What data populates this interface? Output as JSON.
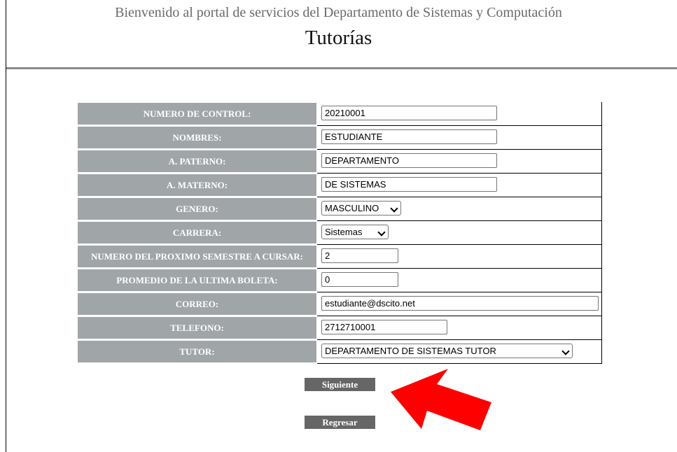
{
  "header": {
    "welcome": "Bienvenido al portal de servicios del Departamento de Sistemas y Computación",
    "title": "Tutorías"
  },
  "form": {
    "rows": [
      {
        "label": "NUMERO DE CONTROL:",
        "value": "20210001"
      },
      {
        "label": "NOMBRES:",
        "value": "ESTUDIANTE"
      },
      {
        "label": "A. PATERNO:",
        "value": "DEPARTAMENTO"
      },
      {
        "label": "A. MATERNO:",
        "value": "DE SISTEMAS"
      },
      {
        "label": "GENERO:",
        "value": "MASCULINO"
      },
      {
        "label": "CARRERA:",
        "value": "Sistemas"
      },
      {
        "label": "NUMERO DEL PROXIMO SEMESTRE A CURSAR:",
        "value": "2"
      },
      {
        "label": "PROMEDIO DE LA ULTIMA BOLETA:",
        "value": "0"
      },
      {
        "label": "CORREO:",
        "value": "estudiante@dscito.net"
      },
      {
        "label": "TELEFONO:",
        "value": "2712710001"
      },
      {
        "label": "TUTOR:",
        "value": "DEPARTAMENTO DE SISTEMAS TUTOR"
      }
    ]
  },
  "buttons": {
    "next_label": "Siguiente",
    "back_label": "Regresar"
  },
  "colors": {
    "label_bg": "#a0a5a8",
    "button_bg": "#666666",
    "annotation_arrow": "#ff0000"
  },
  "icons": {
    "select_chevron": "chevron-down-icon",
    "annotation": "red-arrow-icon"
  }
}
